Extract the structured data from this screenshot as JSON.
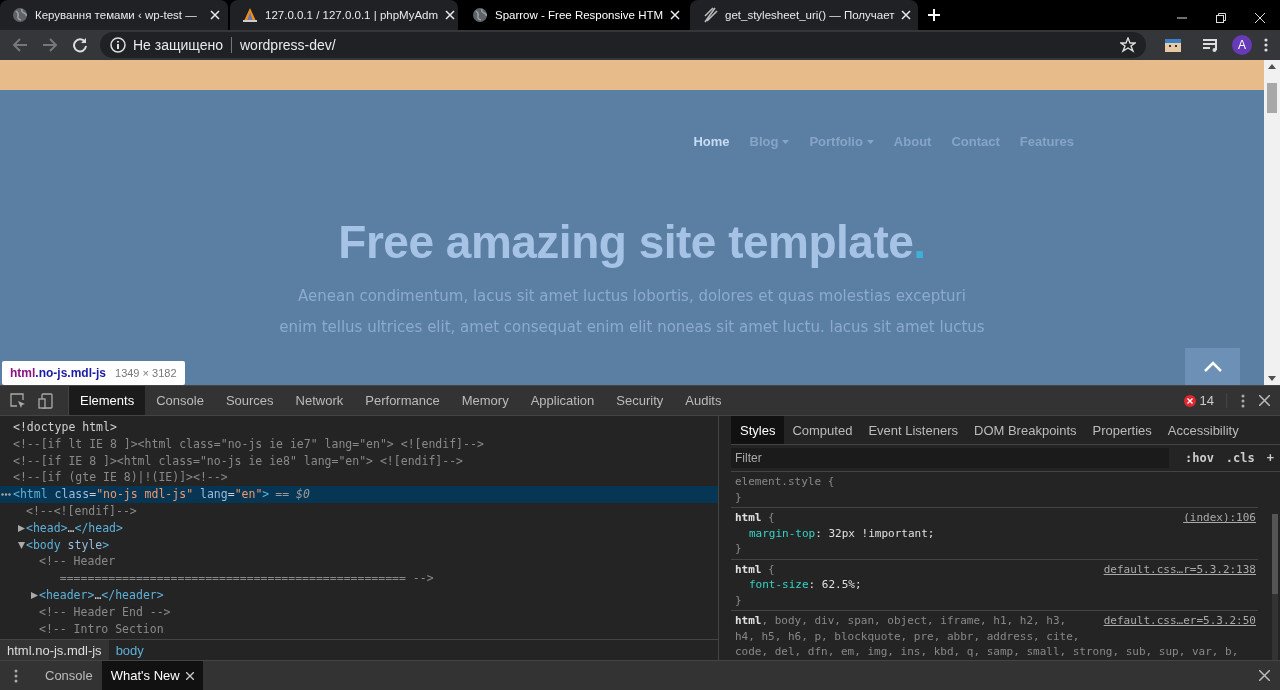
{
  "browser": {
    "tabs": [
      {
        "kind": "globe",
        "title": "Керування темами ‹ wp-test —",
        "selected": false
      },
      {
        "kind": "sail",
        "title": "127.0.0.1 / 127.0.0.1 | phpMyAdm",
        "selected": false
      },
      {
        "kind": "globe",
        "title": "Sparrow - Free Responsive HTM",
        "selected": true
      },
      {
        "kind": "quill",
        "title": "get_stylesheet_uri() — Получает",
        "selected": false
      }
    ],
    "security_label": "Не защищено",
    "url": "wordpress-dev/",
    "profile_initial": "A"
  },
  "site": {
    "nav": [
      {
        "label": "Home",
        "selected": true,
        "dropdown": false
      },
      {
        "label": "Blog",
        "selected": false,
        "dropdown": true
      },
      {
        "label": "Portfolio",
        "selected": false,
        "dropdown": true
      },
      {
        "label": "About",
        "selected": false,
        "dropdown": false
      },
      {
        "label": "Contact",
        "selected": false,
        "dropdown": false
      },
      {
        "label": "Features",
        "selected": false,
        "dropdown": false
      }
    ],
    "heading": "Free amazing site template",
    "heading_mark": ".",
    "intro": "Aenean condimentum, lacus sit amet luctus lobortis, dolores et quas molestias excepturi\nenim tellus ultrices elit, amet consequat enim elit noneas sit amet luctu. lacus sit amet luctus"
  },
  "inspect_tooltip": {
    "tag": "html",
    "classes": ".no-js.mdl-js",
    "size": "1349 × 3182"
  },
  "devtools": {
    "tabs": [
      {
        "label": "Elements",
        "selected": true
      },
      {
        "label": "Console",
        "selected": false
      },
      {
        "label": "Sources",
        "selected": false
      },
      {
        "label": "Network",
        "selected": false
      },
      {
        "label": "Performance",
        "selected": false
      },
      {
        "label": "Memory",
        "selected": false
      },
      {
        "label": "Application",
        "selected": false
      },
      {
        "label": "Security",
        "selected": false
      },
      {
        "label": "Audits",
        "selected": false
      }
    ],
    "error_count": "14",
    "dom": [
      {
        "kind": "doctype",
        "text": "<!doctype html>"
      },
      {
        "kind": "comment",
        "text": "<!--[if lt IE 8 ]><html class=\"no-js ie ie7\" lang=\"en\"> <![endif]-->"
      },
      {
        "kind": "comment",
        "text": "<!--[if IE 8 ]><html class=\"no-js ie ie8\" lang=\"en\"> <![endif]-->"
      },
      {
        "kind": "comment",
        "text": "<!--[if (gte IE 8)|!(IE)]><!-->"
      },
      {
        "kind": "element",
        "text": "<html class=\"no-js mdl-js\" lang=\"en\">",
        "note": "== $0",
        "selected": true,
        "children": [
          {
            "kind": "comment",
            "text": "<!--<![endif]-->"
          },
          {
            "kind": "element",
            "text": "<head>…</head>",
            "expanded": false
          },
          {
            "kind": "element",
            "text": "<body style>",
            "expanded": true,
            "children": [
              {
                "kind": "comment",
                "text": "<!-- Header\n   ================================================== -->"
              },
              {
                "kind": "element",
                "text": "<header>…</header>",
                "expanded": false
              },
              {
                "kind": "comment",
                "text": "<!-- Header End -->"
              },
              {
                "kind": "comment",
                "text": "<!-- Intro Section"
              }
            ]
          }
        ]
      }
    ],
    "breadcrumbs": [
      {
        "label": "html.no-js.mdl-js",
        "selected": true
      },
      {
        "label": "body",
        "selected": false
      }
    ],
    "sidebar_tabs": [
      {
        "label": "Styles",
        "selected": true
      },
      {
        "label": "Computed",
        "selected": false
      },
      {
        "label": "Event Listeners",
        "selected": false
      },
      {
        "label": "DOM Breakpoints",
        "selected": false
      },
      {
        "label": "Properties",
        "selected": false
      },
      {
        "label": "Accessibility",
        "selected": false
      }
    ],
    "filter_placeholder": "Filter",
    "filter_buttons": [
      ":hov",
      ".cls",
      "+"
    ],
    "rules": [
      {
        "selector_lines": [
          "element.style {"
        ],
        "closing": "}"
      },
      {
        "selector_lines": [
          "**html** {"
        ],
        "source": "(index):106",
        "declarations": [
          "margin-top: 32px !important;"
        ],
        "closing": "}"
      },
      {
        "selector_lines": [
          "**html** {"
        ],
        "source": "default.css…r=5.3.2:138",
        "declarations": [
          "font-size: 62.5%;"
        ],
        "closing": "}"
      },
      {
        "selector_lines": [
          "**html**, body, div, span, object, iframe, h1, h2, h3,",
          "h4, h5, h6, p, blockquote, pre, abbr, address, cite,",
          "code, del, dfn, em, img, ins, kbd, q, samp, small, strong, sub, sup, var, b,"
        ],
        "source": "default.css…er=5.3.2:50"
      }
    ]
  },
  "drawer": {
    "tabs": [
      {
        "label": "Console",
        "selected": false,
        "closable": false
      },
      {
        "label": "What's New",
        "selected": true,
        "closable": true
      }
    ]
  }
}
